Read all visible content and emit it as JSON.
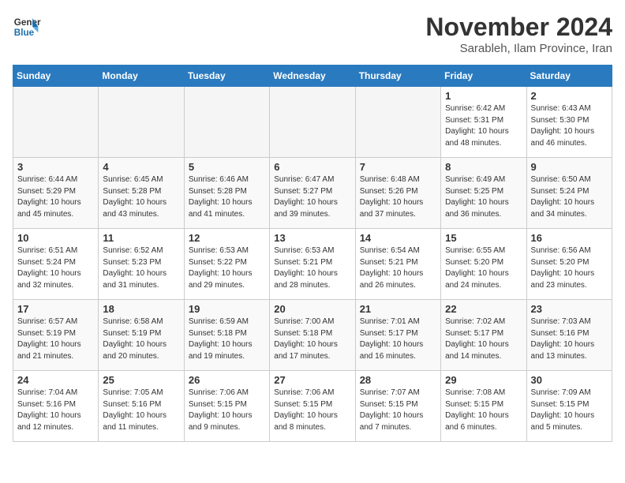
{
  "logo": {
    "line1": "General",
    "line2": "Blue"
  },
  "title": "November 2024",
  "location": "Sarableh, Ilam Province, Iran",
  "days_of_week": [
    "Sunday",
    "Monday",
    "Tuesday",
    "Wednesday",
    "Thursday",
    "Friday",
    "Saturday"
  ],
  "weeks": [
    [
      {
        "day": null
      },
      {
        "day": null
      },
      {
        "day": null
      },
      {
        "day": null
      },
      {
        "day": null
      },
      {
        "day": "1",
        "sunrise": "Sunrise: 6:42 AM",
        "sunset": "Sunset: 5:31 PM",
        "daylight": "Daylight: 10 hours and 48 minutes."
      },
      {
        "day": "2",
        "sunrise": "Sunrise: 6:43 AM",
        "sunset": "Sunset: 5:30 PM",
        "daylight": "Daylight: 10 hours and 46 minutes."
      }
    ],
    [
      {
        "day": "3",
        "sunrise": "Sunrise: 6:44 AM",
        "sunset": "Sunset: 5:29 PM",
        "daylight": "Daylight: 10 hours and 45 minutes."
      },
      {
        "day": "4",
        "sunrise": "Sunrise: 6:45 AM",
        "sunset": "Sunset: 5:28 PM",
        "daylight": "Daylight: 10 hours and 43 minutes."
      },
      {
        "day": "5",
        "sunrise": "Sunrise: 6:46 AM",
        "sunset": "Sunset: 5:28 PM",
        "daylight": "Daylight: 10 hours and 41 minutes."
      },
      {
        "day": "6",
        "sunrise": "Sunrise: 6:47 AM",
        "sunset": "Sunset: 5:27 PM",
        "daylight": "Daylight: 10 hours and 39 minutes."
      },
      {
        "day": "7",
        "sunrise": "Sunrise: 6:48 AM",
        "sunset": "Sunset: 5:26 PM",
        "daylight": "Daylight: 10 hours and 37 minutes."
      },
      {
        "day": "8",
        "sunrise": "Sunrise: 6:49 AM",
        "sunset": "Sunset: 5:25 PM",
        "daylight": "Daylight: 10 hours and 36 minutes."
      },
      {
        "day": "9",
        "sunrise": "Sunrise: 6:50 AM",
        "sunset": "Sunset: 5:24 PM",
        "daylight": "Daylight: 10 hours and 34 minutes."
      }
    ],
    [
      {
        "day": "10",
        "sunrise": "Sunrise: 6:51 AM",
        "sunset": "Sunset: 5:24 PM",
        "daylight": "Daylight: 10 hours and 32 minutes."
      },
      {
        "day": "11",
        "sunrise": "Sunrise: 6:52 AM",
        "sunset": "Sunset: 5:23 PM",
        "daylight": "Daylight: 10 hours and 31 minutes."
      },
      {
        "day": "12",
        "sunrise": "Sunrise: 6:53 AM",
        "sunset": "Sunset: 5:22 PM",
        "daylight": "Daylight: 10 hours and 29 minutes."
      },
      {
        "day": "13",
        "sunrise": "Sunrise: 6:53 AM",
        "sunset": "Sunset: 5:21 PM",
        "daylight": "Daylight: 10 hours and 28 minutes."
      },
      {
        "day": "14",
        "sunrise": "Sunrise: 6:54 AM",
        "sunset": "Sunset: 5:21 PM",
        "daylight": "Daylight: 10 hours and 26 minutes."
      },
      {
        "day": "15",
        "sunrise": "Sunrise: 6:55 AM",
        "sunset": "Sunset: 5:20 PM",
        "daylight": "Daylight: 10 hours and 24 minutes."
      },
      {
        "day": "16",
        "sunrise": "Sunrise: 6:56 AM",
        "sunset": "Sunset: 5:20 PM",
        "daylight": "Daylight: 10 hours and 23 minutes."
      }
    ],
    [
      {
        "day": "17",
        "sunrise": "Sunrise: 6:57 AM",
        "sunset": "Sunset: 5:19 PM",
        "daylight": "Daylight: 10 hours and 21 minutes."
      },
      {
        "day": "18",
        "sunrise": "Sunrise: 6:58 AM",
        "sunset": "Sunset: 5:19 PM",
        "daylight": "Daylight: 10 hours and 20 minutes."
      },
      {
        "day": "19",
        "sunrise": "Sunrise: 6:59 AM",
        "sunset": "Sunset: 5:18 PM",
        "daylight": "Daylight: 10 hours and 19 minutes."
      },
      {
        "day": "20",
        "sunrise": "Sunrise: 7:00 AM",
        "sunset": "Sunset: 5:18 PM",
        "daylight": "Daylight: 10 hours and 17 minutes."
      },
      {
        "day": "21",
        "sunrise": "Sunrise: 7:01 AM",
        "sunset": "Sunset: 5:17 PM",
        "daylight": "Daylight: 10 hours and 16 minutes."
      },
      {
        "day": "22",
        "sunrise": "Sunrise: 7:02 AM",
        "sunset": "Sunset: 5:17 PM",
        "daylight": "Daylight: 10 hours and 14 minutes."
      },
      {
        "day": "23",
        "sunrise": "Sunrise: 7:03 AM",
        "sunset": "Sunset: 5:16 PM",
        "daylight": "Daylight: 10 hours and 13 minutes."
      }
    ],
    [
      {
        "day": "24",
        "sunrise": "Sunrise: 7:04 AM",
        "sunset": "Sunset: 5:16 PM",
        "daylight": "Daylight: 10 hours and 12 minutes."
      },
      {
        "day": "25",
        "sunrise": "Sunrise: 7:05 AM",
        "sunset": "Sunset: 5:16 PM",
        "daylight": "Daylight: 10 hours and 11 minutes."
      },
      {
        "day": "26",
        "sunrise": "Sunrise: 7:06 AM",
        "sunset": "Sunset: 5:15 PM",
        "daylight": "Daylight: 10 hours and 9 minutes."
      },
      {
        "day": "27",
        "sunrise": "Sunrise: 7:06 AM",
        "sunset": "Sunset: 5:15 PM",
        "daylight": "Daylight: 10 hours and 8 minutes."
      },
      {
        "day": "28",
        "sunrise": "Sunrise: 7:07 AM",
        "sunset": "Sunset: 5:15 PM",
        "daylight": "Daylight: 10 hours and 7 minutes."
      },
      {
        "day": "29",
        "sunrise": "Sunrise: 7:08 AM",
        "sunset": "Sunset: 5:15 PM",
        "daylight": "Daylight: 10 hours and 6 minutes."
      },
      {
        "day": "30",
        "sunrise": "Sunrise: 7:09 AM",
        "sunset": "Sunset: 5:15 PM",
        "daylight": "Daylight: 10 hours and 5 minutes."
      }
    ]
  ]
}
